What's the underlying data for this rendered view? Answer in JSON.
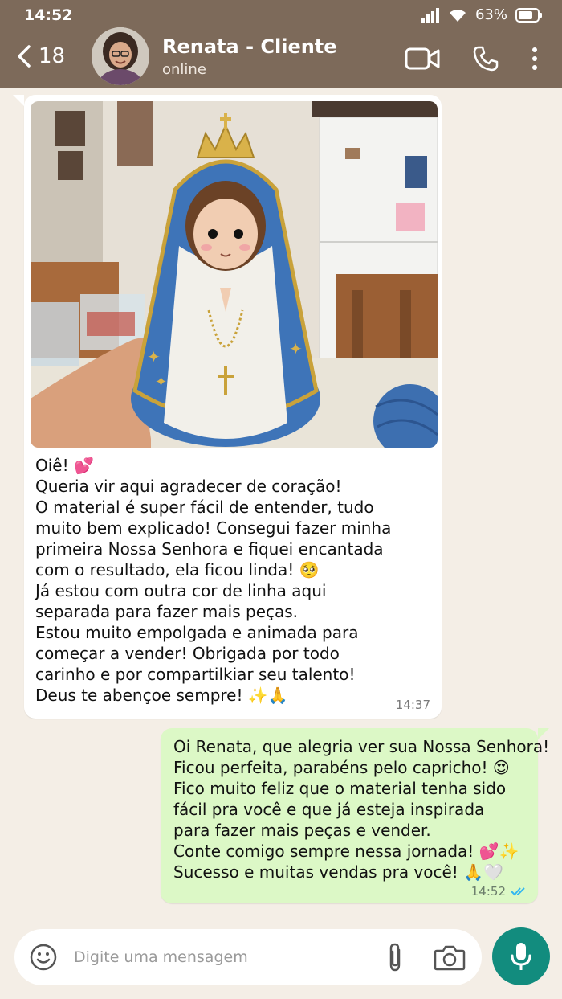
{
  "status": {
    "time": "14:52",
    "battery": "63%"
  },
  "header": {
    "back_count": "18",
    "contact_name": "Renata - Cliente",
    "contact_status": "online"
  },
  "incoming": {
    "lines": [
      "Oiê! 💕",
      "Queria vir aqui agradecer de coração!",
      "O material é super fácil de entender, tudo",
      "muito bem explicado! Consegui fazer minha",
      "primeira Nossa Senhora e fiquei encantada",
      "com o resultado, ela ficou linda! 🥺",
      "Já estou com outra cor de linha aqui",
      "separada para fazer mais peças.",
      "Estou muito empolgada e animada para",
      "começar a vender! Obrigada por todo",
      "carinho e por compartilkiar seu talento!",
      "Deus te abençoe sempre! ✨🙏"
    ],
    "time": "14:37"
  },
  "outgoing": {
    "lines": [
      "Oi Renata, que alegria ver sua Nossa Senhora!",
      "Ficou perfeita, parabéns pelo capricho! 😍",
      "Fico muito feliz que o material tenha sido",
      "fácil pra você e que já esteja inspirada",
      "para fazer mais peças e vender.",
      "Conte comigo sempre nessa jornada! 💕✨",
      "Sucesso e muitas vendas pra você! 🙏🤍"
    ],
    "time": "14:52"
  },
  "composer": {
    "placeholder": "Digite uma mensagem"
  },
  "colors": {
    "header": "#7d6a5a",
    "chat_bg": "#f4eee6",
    "out_bubble": "#dcf8c6",
    "mic": "#128c7e",
    "read_ticks": "#34b7f1"
  },
  "icons": [
    "signal-icon",
    "wifi-icon",
    "battery-icon",
    "back-chevron-icon",
    "video-call-icon",
    "phone-icon",
    "more-icon",
    "emoji-icon",
    "attach-icon",
    "camera-icon",
    "mic-icon",
    "read-receipt-icon"
  ]
}
